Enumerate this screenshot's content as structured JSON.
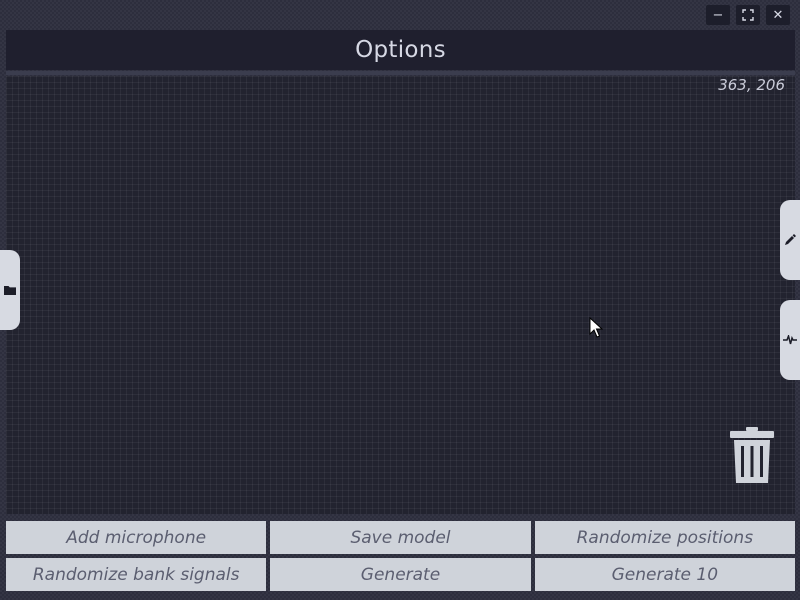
{
  "window_controls": {
    "minimize": "−",
    "maximize": "⛶",
    "close": "✕"
  },
  "header": {
    "title": "Options"
  },
  "canvas": {
    "coordinate_readout": "363, 206"
  },
  "side_tabs": {
    "left_icon": "folder-icon",
    "right_icons": [
      "pen-icon",
      "waveform-icon"
    ]
  },
  "trash_icon": "trash-icon",
  "buttons": {
    "add_microphone": "Add microphone",
    "save_model": "Save model",
    "randomize_positions": "Randomize positions",
    "randomize_bank_signals": "Randomize bank signals",
    "generate": "Generate",
    "generate_10": "Generate 10"
  },
  "colors": {
    "background": "#2d2e3d",
    "header": "#1f1f2e",
    "canvas": "#22232f",
    "button": "#cfd3da",
    "button_text": "#5b5e70",
    "side_tab": "#d7dae2",
    "trash": "#cfd3da"
  }
}
